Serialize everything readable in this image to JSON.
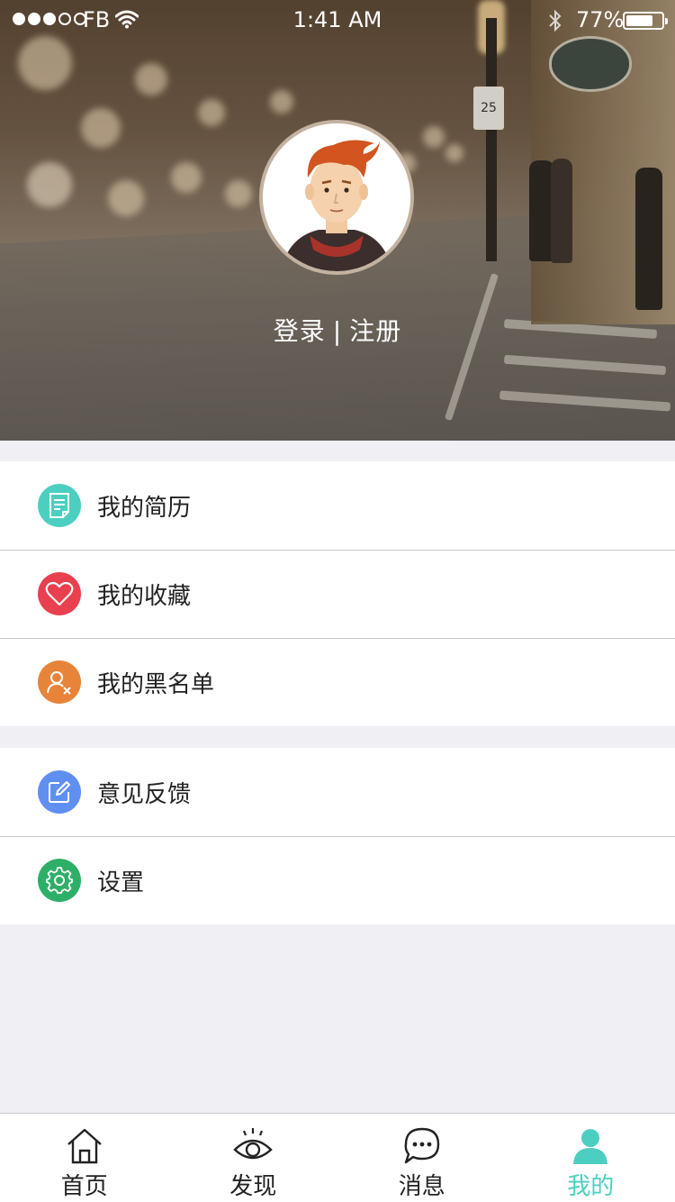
{
  "status_bar": {
    "carrier": "FB",
    "time": "1:41 AM",
    "battery": "77%",
    "battery_level": 0.77,
    "signal_dots_filled": 3,
    "signal_dots_total": 5
  },
  "hero": {
    "speed_limit": "25",
    "login_label": "登录",
    "separator": "|",
    "register_label": "注册"
  },
  "menu": {
    "group1": [
      {
        "label": "我的简历",
        "icon": "resume-icon",
        "color": "#4ccfc0"
      },
      {
        "label": "我的收藏",
        "icon": "heart-icon",
        "color": "#e8404f"
      },
      {
        "label": "我的黑名单",
        "icon": "blacklist-user-icon",
        "color": "#e8843a"
      }
    ],
    "group2": [
      {
        "label": "意见反馈",
        "icon": "feedback-edit-icon",
        "color": "#5f8ff0"
      },
      {
        "label": "设置",
        "icon": "gear-icon",
        "color": "#2eaf68"
      }
    ]
  },
  "tabs": [
    {
      "label": "首页",
      "icon": "home-icon",
      "active": false
    },
    {
      "label": "发现",
      "icon": "eye-icon",
      "active": false
    },
    {
      "label": "消息",
      "icon": "chat-bubble-icon",
      "active": false
    },
    {
      "label": "我的",
      "icon": "person-icon",
      "active": true
    }
  ],
  "colors": {
    "accent": "#4ccfc0",
    "background": "#efeff4",
    "divider": "#c8c7cc"
  }
}
